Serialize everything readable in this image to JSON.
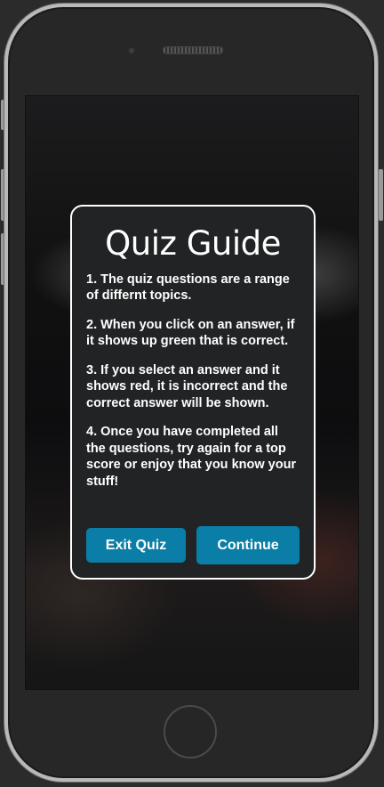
{
  "guide": {
    "title": "Quiz Guide",
    "rules": [
      "1. The quiz questions are a range of differnt topics.",
      "2. When you click on an answer, if it shows up green that is correct.",
      "3. If you select an answer and it shows red, it is incorrect and the correct answer will be shown.",
      "4. Once you have completed all the questions, try again for a top score or enjoy that you know your stuff!"
    ],
    "exit_label": "Exit Quiz",
    "continue_label": "Continue"
  },
  "colors": {
    "button": "#0a7ea6",
    "modal_bg": "#222324",
    "modal_border": "#ffffff"
  }
}
